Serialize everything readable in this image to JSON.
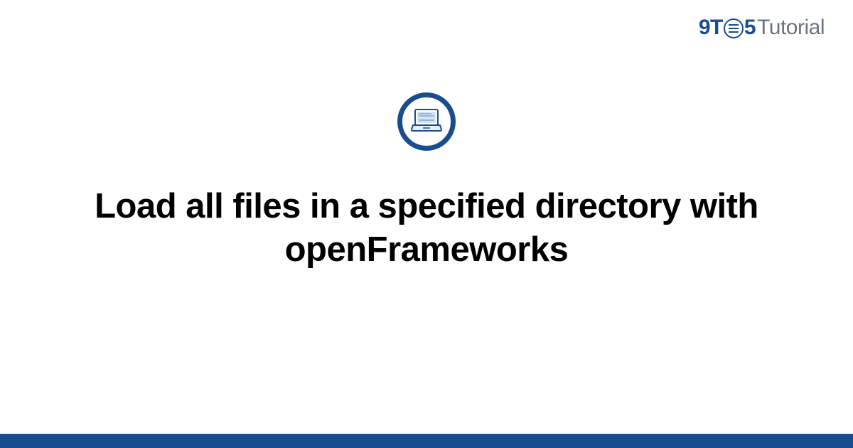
{
  "logo": {
    "part1": "9T",
    "part2": "5",
    "part3": "Tutorial"
  },
  "title": "Load all files in a specified directory with openFrameworks",
  "colors": {
    "brand": "#1a4d8f",
    "muted": "#6b7280",
    "lightblue": "#a8c5e8"
  }
}
